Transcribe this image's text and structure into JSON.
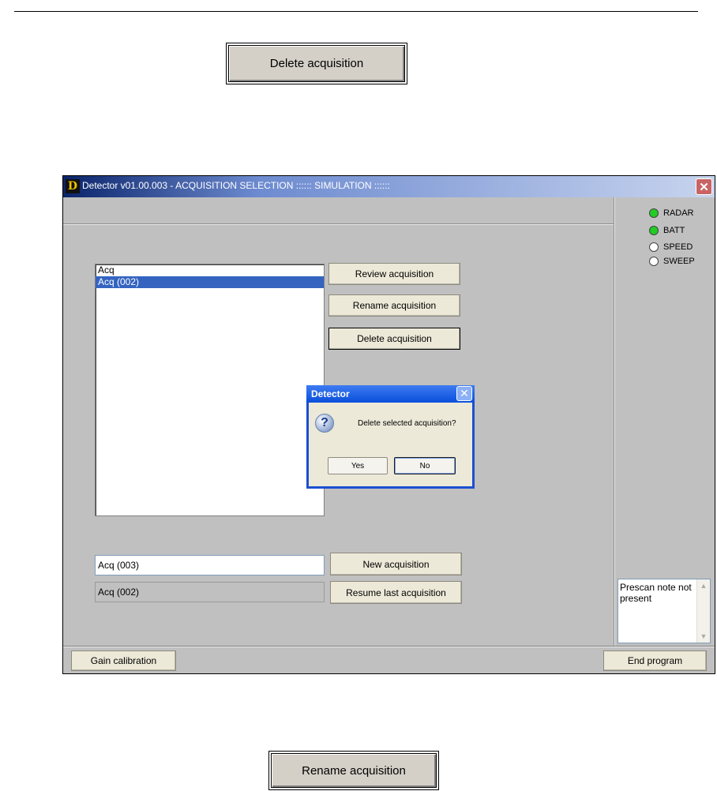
{
  "doc": {
    "top_button_label": "Delete acquisition",
    "bottom_button_label": "Rename acquisition"
  },
  "window": {
    "app_icon_letter": "D",
    "title": "Detector v01.00.003 - ACQUISITION SELECTION  :::::: SIMULATION ::::::",
    "close_glyph": "✕"
  },
  "status": {
    "items": [
      {
        "label": "RADAR",
        "color": "#22cc22"
      },
      {
        "label": "BATT",
        "color": "#22cc22"
      },
      {
        "label": "SPEED",
        "color": "#ffffff"
      },
      {
        "label": "SWEEP",
        "color": "#ffffff"
      }
    ]
  },
  "list": {
    "items": [
      "Acq",
      "Acq (002)"
    ],
    "selected_index": 1
  },
  "buttons": {
    "review": "Review acquisition",
    "rename": "Rename acquisition",
    "delete": "Delete acquisition",
    "new": "New acquisition",
    "resume": "Resume last acquisition",
    "gain": "Gain calibration",
    "end": "End program"
  },
  "fields": {
    "new_name_value": "Acq (003)",
    "last_acq_value": "Acq (002)"
  },
  "note": {
    "text": "Prescan note not present"
  },
  "dialog": {
    "title": "Detector",
    "close_glyph": "✕",
    "icon_glyph": "?",
    "message": "Delete selected acquisition?",
    "yes": "Yes",
    "no": "No"
  }
}
